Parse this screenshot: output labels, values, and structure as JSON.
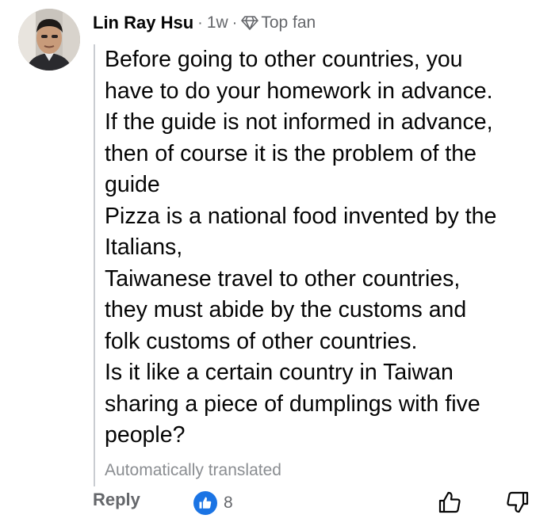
{
  "comment": {
    "author": "Lin Ray Hsu",
    "separator": "·",
    "time": "1w",
    "badge_icon": "diamond-icon",
    "badge_label": "Top fan",
    "lines": [
      "Before going to other countries, you",
      "have to do your homework in advance.",
      "If the guide is not informed in advance,",
      "then of course it is the problem of the",
      "guide",
      "Pizza is a national food invented by the",
      "Italians,",
      "Taiwanese travel to other countries,",
      "they must abide by the customs and",
      "folk customs of other countries.",
      "Is it like a certain country in Taiwan",
      "sharing a piece of dumplings with five",
      "people?"
    ],
    "translation_note": "Automatically translated"
  },
  "actions": {
    "reply_label": "Reply",
    "like_count": "8",
    "like_icon": "thumbs-up-icon",
    "dislike_icon": "thumbs-down-icon"
  },
  "colors": {
    "accent": "#1b74e4",
    "muted": "#65676b",
    "text": "#050505"
  }
}
